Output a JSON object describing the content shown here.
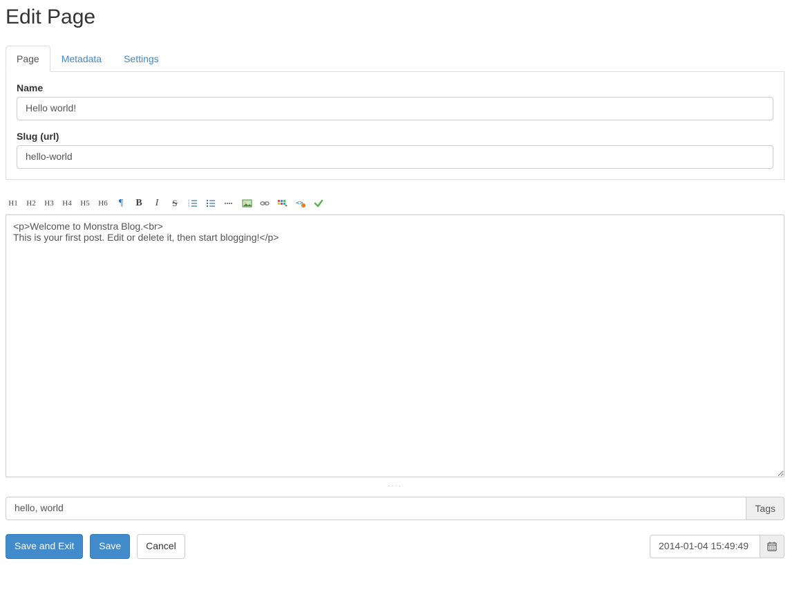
{
  "header": {
    "title": "Edit Page"
  },
  "tabs": [
    {
      "label": "Page",
      "active": true
    },
    {
      "label": "Metadata",
      "active": false
    },
    {
      "label": "Settings",
      "active": false
    }
  ],
  "form": {
    "name_label": "Name",
    "name_value": "Hello world!",
    "slug_label": "Slug (url)",
    "slug_value": "hello-world"
  },
  "toolbar": {
    "h1": "H1",
    "h2": "H2",
    "h3": "H3",
    "h4": "H4",
    "h5": "H5",
    "h6": "H6",
    "pilcrow": "¶",
    "bold": "B",
    "italic": "I",
    "strike": "S"
  },
  "editor": {
    "content": "<p>Welcome to Monstra Blog.<br>\nThis is your first post. Edit or delete it, then start blogging!</p>"
  },
  "tags": {
    "value": "hello, world",
    "addon": "Tags"
  },
  "buttons": {
    "save_exit": "Save and Exit",
    "save": "Save",
    "cancel": "Cancel"
  },
  "date": {
    "value": "2014-01-04 15:49:49"
  }
}
